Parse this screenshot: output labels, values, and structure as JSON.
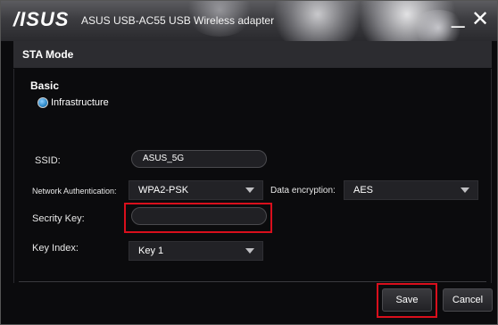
{
  "titlebar": {
    "logo": "/ISUS",
    "title": "ASUS USB-AC55 USB Wireless adapter",
    "minimize": "_",
    "close": "✕"
  },
  "header": {
    "label": "STA Mode"
  },
  "basic": {
    "title": "Basic",
    "radio_label": "Infrastructure"
  },
  "form": {
    "ssid_label": "SSID:",
    "ssid_value": "ASUS_5G",
    "auth_label": "Network Authentication:",
    "auth_value": "WPA2-PSK",
    "encryption_label": "Data encryption:",
    "encryption_value": "AES",
    "key_label": "Secrity Key:",
    "key_value": "",
    "key_index_label": "Key Index:",
    "key_index_value": "Key 1"
  },
  "buttons": {
    "save": "Save",
    "cancel": "Cancel"
  },
  "colors": {
    "highlight": "#d90f1c",
    "radio_selected": "#2c88c8"
  }
}
